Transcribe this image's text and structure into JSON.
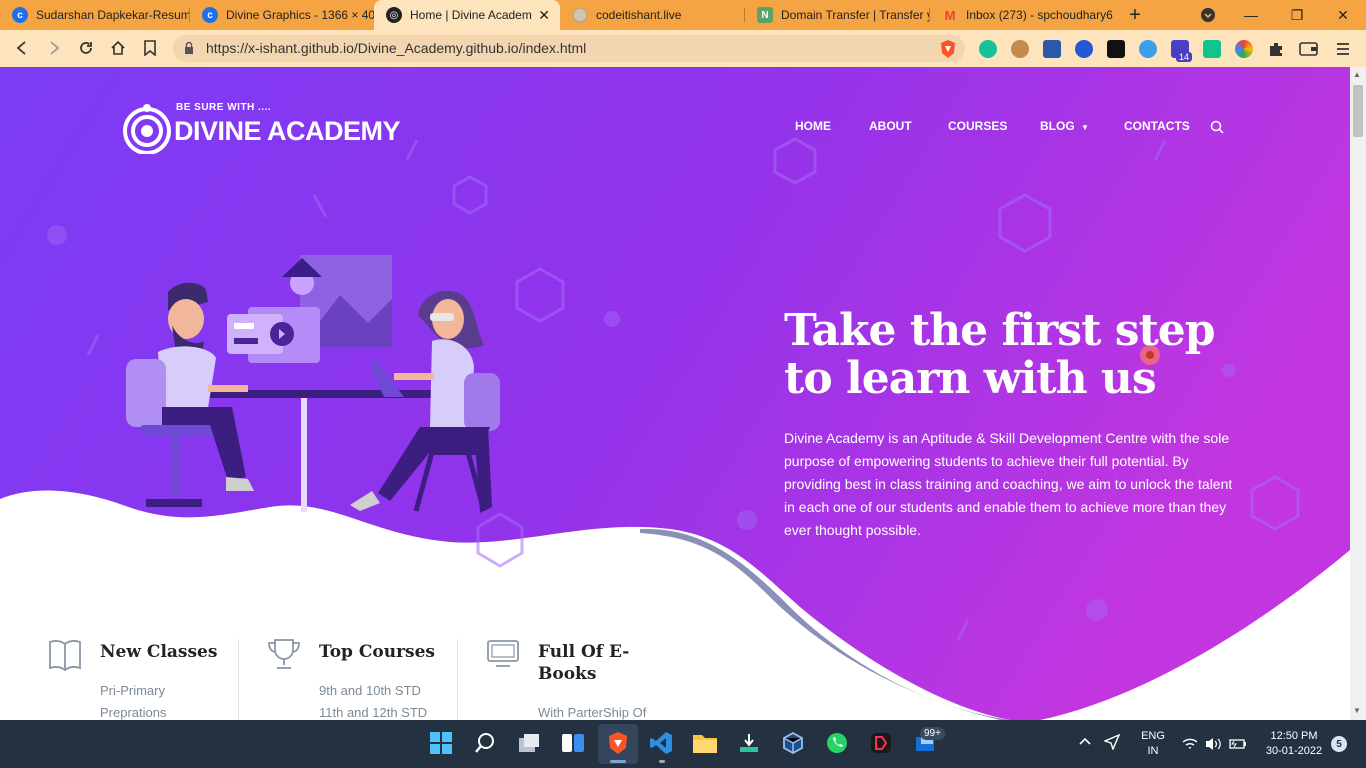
{
  "browser": {
    "tabs": [
      {
        "title": "Sudarshan Dapkekar-Resum",
        "fav": "c",
        "color": "#1f6feb"
      },
      {
        "title": "Divine Graphics - 1366 × 40",
        "fav": "c",
        "color": "#1f6feb"
      },
      {
        "title": "Home | Divine Academy",
        "fav": "d",
        "color": "#222222",
        "active": true
      },
      {
        "title": "codeitishant.live",
        "fav": "",
        "color": "#b9b9b9"
      },
      {
        "title": "Domain Transfer | Transfer y",
        "fav": "N",
        "color": "#5aa469"
      },
      {
        "title": "Inbox (273) - spchoudhary6",
        "fav": "M",
        "color": "#ea4335"
      }
    ],
    "url": "https://x-ishant.github.io/Divine_Academy.github.io/index.html",
    "new_tab_label": "+",
    "extensions_badge": "14"
  },
  "site": {
    "logo_tagline": "BE SURE WITH ....",
    "logo_name": "DIVINE ACADEMY",
    "nav": [
      {
        "label": "HOME"
      },
      {
        "label": "ABOUT"
      },
      {
        "label": "COURSES"
      },
      {
        "label": "BLOG"
      },
      {
        "label": "CONTACTS"
      }
    ],
    "hero": {
      "headline_line1": "Take the first step",
      "headline_line2": "to learn with us",
      "description": "Divine Academy is an Aptitude & Skill Development Centre with the sole purpose of empowering students to achieve their full potential. By providing best in class training and coaching, we aim to unlock the talent in each one of our students and enable them to achieve more than they ever thought possible."
    },
    "features": [
      {
        "title": "New Classes",
        "title2": "",
        "lines": [
          "Pri-Primary",
          "Preprations"
        ],
        "icon": "book-icon"
      },
      {
        "title": "Top Courses",
        "title2": "",
        "lines": [
          "9th and 10th STD",
          "11th and 12th STD"
        ],
        "icon": "trophy-icon"
      },
      {
        "title": "Full Of E-",
        "title2": "Books",
        "lines": [
          "With ParterShip Of"
        ],
        "icon": "monitor-icon"
      }
    ],
    "colors": {
      "hero_left": "#7b3cf5",
      "hero_right": "#c136e0",
      "accent": "#f5a443"
    }
  },
  "taskbar": {
    "language": "ENG",
    "region": "IN",
    "time": "12:50 PM",
    "date": "30-01-2022",
    "notifications": "5",
    "badge": "99+"
  }
}
